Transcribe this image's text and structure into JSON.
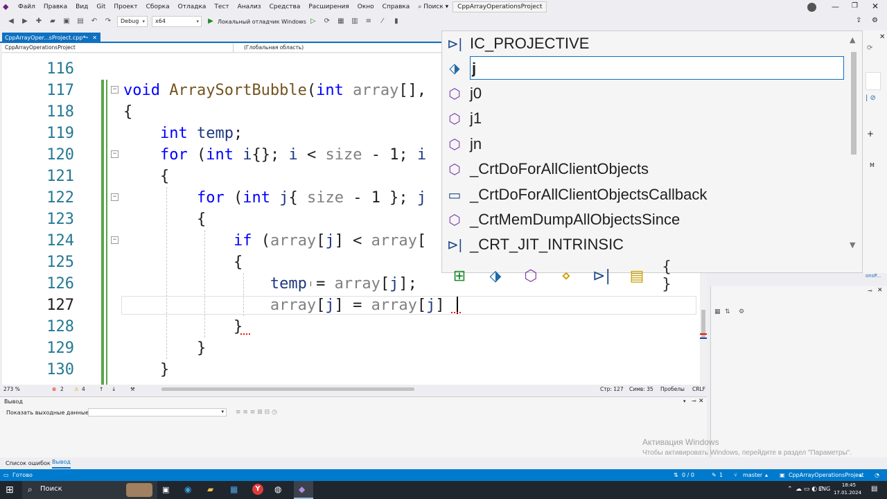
{
  "menu": [
    "Файл",
    "Правка",
    "Вид",
    "Git",
    "Проект",
    "Сборка",
    "Отладка",
    "Тест",
    "Анализ",
    "Средства",
    "Расширения",
    "Окно",
    "Справка",
    "Поиск",
    "CppArrayOperationsProject"
  ],
  "toolbar": {
    "config": "Debug",
    "platform": "x64",
    "debugger": "Локальный отладчик Windows"
  },
  "doc_tab": {
    "label": "CppArrayOper...sProject.cpp*"
  },
  "nav": {
    "project": "CppArrayOperationsProject",
    "scope": "(Глобальная область)"
  },
  "code": {
    "line_numbers": [
      "116",
      "117",
      "118",
      "119",
      "120",
      "121",
      "122",
      "123",
      "124",
      "125",
      "126",
      "127",
      "128",
      "129",
      "130"
    ],
    "lines": [
      "",
      "void ArraySortBubble(int array[],",
      "{",
      "    int temp;",
      "    for (int i{}; i < size - 1; i",
      "    {",
      "        for (int j{ size - 1 }; j",
      "        {",
      "            if (array[j] < array[",
      "            {",
      "                temp = array[j];",
      "                array[j] = array[j]",
      "            }",
      "        }",
      "    }"
    ]
  },
  "completion": {
    "items": [
      {
        "label": "IC_PROJECTIVE",
        "icon": "macro-icon"
      },
      {
        "label": "j",
        "icon": "local-variable-icon"
      },
      {
        "label": "j0",
        "icon": "function-icon"
      },
      {
        "label": "j1",
        "icon": "function-icon"
      },
      {
        "label": "jn",
        "icon": "function-icon"
      },
      {
        "label": "_CrtDoForAllClientObjects",
        "icon": "function-icon"
      },
      {
        "label": "_CrtDoForAllClientObjectsCallback",
        "icon": "typedef-icon"
      },
      {
        "label": "_CrtMemDumpAllObjectsSince",
        "icon": "function-icon"
      },
      {
        "label": "_CRT_JIT_INTRINSIC",
        "icon": "macro-icon"
      }
    ],
    "filters": [
      "expand-icon",
      "variable-filter-icon",
      "function-filter-icon",
      "member-filter-icon",
      "macro-filter-icon",
      "type-filter-icon",
      "snippet-filter-icon"
    ]
  },
  "editor_status": {
    "zoom": "273 %",
    "errors": "2",
    "warnings": "4",
    "line": "Стр: 127",
    "col": "Симв: 35",
    "spaces": "Пробелы",
    "eol": "CRLF"
  },
  "output": {
    "title": "Вывод",
    "show_label": "Показать выходные данные из:"
  },
  "bottom_tabs": [
    "Список ошибок",
    "Вывод"
  ],
  "status": {
    "ready": "Готово",
    "sync": "0 / 0",
    "pencil": "1",
    "branch": "master",
    "project": "CppArrayOperationsProject"
  },
  "watermark": {
    "line1": "Активация Windows",
    "line2": "Чтобы активировать Windows, перейдите в раздел \"Параметры\"."
  },
  "taskbar": {
    "search": "Поиск",
    "lang": "ENG",
    "time": "18:45",
    "date": "17.01.2024"
  },
  "side_labels": {
    "m": "M",
    "ons": "onsP..."
  }
}
